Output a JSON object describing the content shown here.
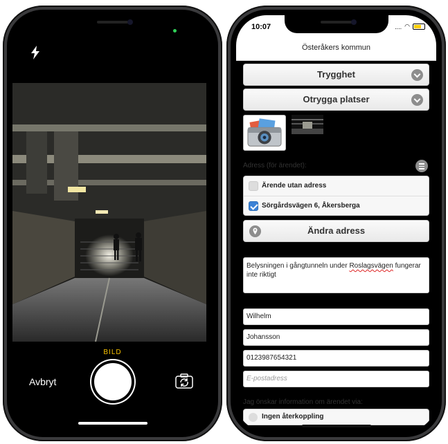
{
  "camera": {
    "mode_label": "BILD",
    "cancel_label": "Avbryt",
    "icons": [
      "flash-icon",
      "shutter-button",
      "flip-camera-icon"
    ]
  },
  "form": {
    "status": {
      "time": "10:07",
      "signal": "...."
    },
    "header_title": "Österåkers kommun",
    "category": "Trygghet",
    "subcategory": "Otrygga platser",
    "address_label": "Adress (för ärendet):",
    "no_address_label": "Ärende utan adress",
    "address_value": "Sörgårdsvägen 6, Åkersberga",
    "change_address_label": "Ändra adress",
    "description_part1": "Belysningen i gångtunneln under ",
    "description_spell": "Roslagsvägen",
    "description_part2": " fungerar inte riktigt",
    "first_name": "Wilhelm",
    "last_name": "Johansson",
    "phone": "0123987654321",
    "email_placeholder": "E-postadress",
    "info_label": "Jag önskar information om ärendet via:",
    "no_feedback_label": "Ingen återkoppling"
  },
  "colors": {
    "accent_yellow": "#f7c000",
    "checkbox_blue": "#3b82d6",
    "indicator_green": "#30d158"
  }
}
